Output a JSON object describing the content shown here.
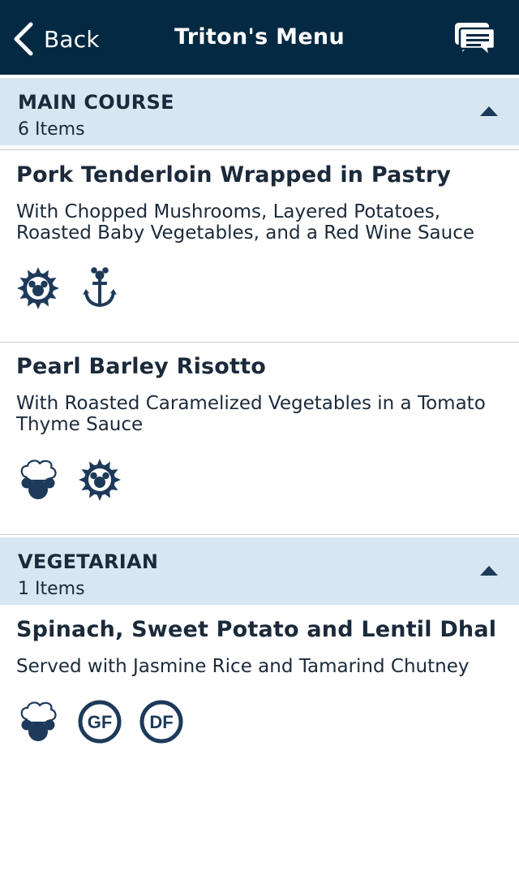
{
  "nav": {
    "back_label": "Back",
    "title": "Triton's Menu",
    "chat_icon": "chat-bubbles-icon"
  },
  "sections": [
    {
      "title": "MAIN COURSE",
      "count": "6 Items",
      "expanded": true,
      "items": [
        {
          "name": "Pork Tenderloin Wrapped in Pastry",
          "description": "With Chopped Mushrooms, Layered Potatoes, Roasted Baby Vegetables, and a Red Wine Sauce",
          "icons": [
            "sun-mickey-icon",
            "anchor-mickey-icon"
          ]
        },
        {
          "name": "Pearl Barley Risotto",
          "description": "With Roasted Caramelized Vegetables in a Tomato Thyme Sauce",
          "icons": [
            "chef-mickey-icon",
            "sun-mickey-icon"
          ]
        }
      ]
    },
    {
      "title": "VEGETARIAN",
      "count": "1 Items",
      "expanded": true,
      "items": [
        {
          "name": "Spinach, Sweet Potato and Lentil Dhal",
          "description": "Served with Jasmine Rice and Tamarind Chutney",
          "icons": [
            "chef-mickey-icon",
            "gluten-free-icon",
            "dairy-free-icon"
          ]
        }
      ]
    }
  ],
  "badges": {
    "gluten_free": "GF",
    "dairy_free": "DF"
  },
  "colors": {
    "navbar": "#042942",
    "section_header": "#d7e6f1",
    "icon": "#1e3a5a",
    "text": "#1b2a3a"
  }
}
